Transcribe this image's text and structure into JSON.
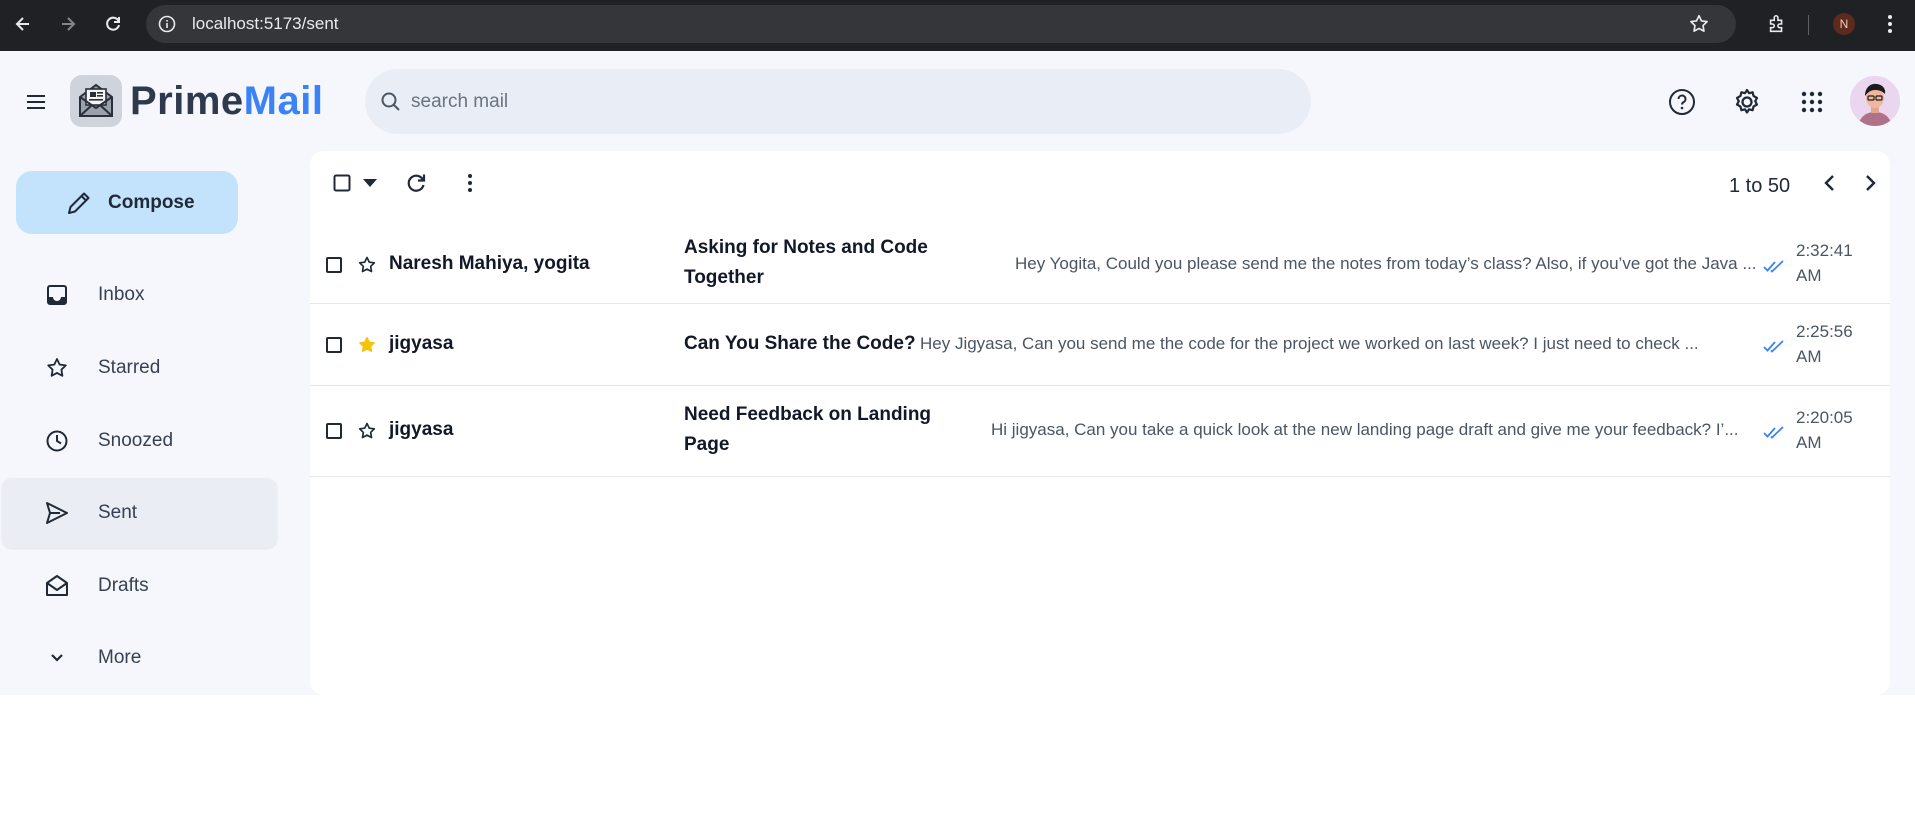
{
  "browser": {
    "url": "localhost:5173/sent",
    "profile_initial": "N"
  },
  "header": {
    "brand_part1": "Prime",
    "brand_part2": "Mail",
    "search_placeholder": "search mail"
  },
  "sidebar": {
    "compose_label": "Compose",
    "items": [
      {
        "label": "Inbox",
        "icon": "inbox-icon"
      },
      {
        "label": "Starred",
        "icon": "star-icon"
      },
      {
        "label": "Snoozed",
        "icon": "clock-icon"
      },
      {
        "label": "Sent",
        "icon": "send-icon",
        "active": true
      },
      {
        "label": "Drafts",
        "icon": "drafts-icon"
      },
      {
        "label": "More",
        "icon": "chevron-down-icon"
      }
    ]
  },
  "toolbar": {
    "pagination": "1 to 50"
  },
  "emails": [
    {
      "sender": "Naresh Mahiya, yogita",
      "subject_line1": "Asking for Notes and Code",
      "subject_line2": "Together",
      "snippet": "Hey Yogita, Could you please send me the notes from today’s class? Also, if you’ve got the Java ...",
      "time_line1": "2:32:41",
      "time_line2": "AM",
      "starred": false
    },
    {
      "sender": "jigyasa",
      "subject_line1": "Can You Share the Code?",
      "subject_line2": "",
      "snippet": "Hey Jigyasa, Can you send me the code for the project we worked on last week? I just need to check ...",
      "time_line1": "2:25:56",
      "time_line2": "AM",
      "starred": true
    },
    {
      "sender": "jigyasa",
      "subject_line1": "Need Feedback on Landing",
      "subject_line2": "Page",
      "snippet": "Hi jigyasa, Can you take a quick look at the new landing page draft and give me your feedback? I’...",
      "time_line1": "2:20:05",
      "time_line2": "AM",
      "starred": false
    }
  ],
  "colors": {
    "brand_blue": "#3b82f6",
    "compose_bg": "#c2e3fb",
    "star_filled": "#f6c20a",
    "read_tick": "#3b82f6"
  }
}
